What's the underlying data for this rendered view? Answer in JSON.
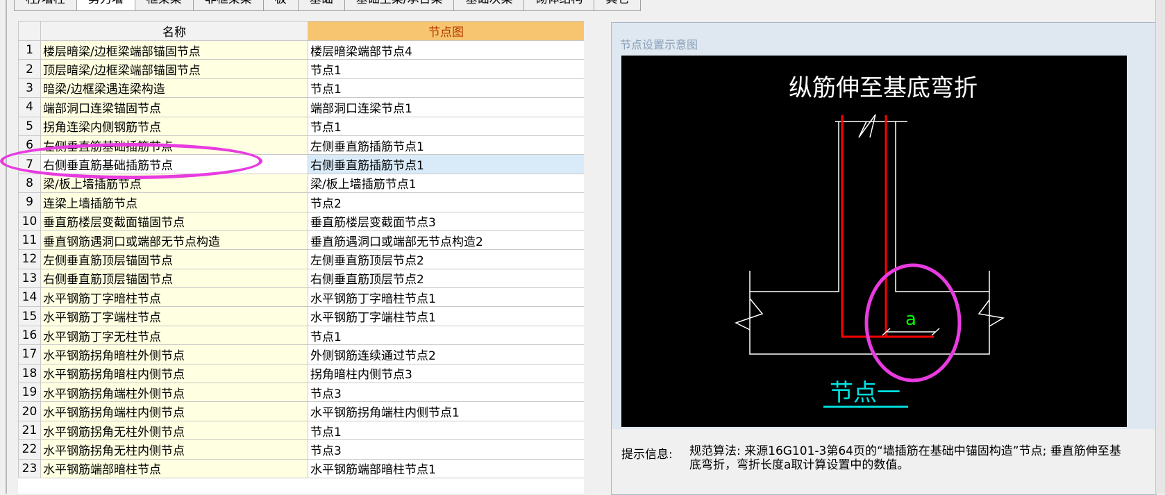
{
  "tabs": [
    {
      "label": "柱/墙柱",
      "active": false
    },
    {
      "label": "剪力墙",
      "active": true
    },
    {
      "label": "框架梁",
      "active": false
    },
    {
      "label": "非框架梁",
      "active": false
    },
    {
      "label": "板",
      "active": false
    },
    {
      "label": "基础",
      "active": false
    },
    {
      "label": "基础主梁/承台梁",
      "active": false
    },
    {
      "label": "基础次梁",
      "active": false
    },
    {
      "label": "砌体结构",
      "active": false
    },
    {
      "label": "其它",
      "active": false
    }
  ],
  "table": {
    "headers": {
      "name": "名称",
      "node": "节点图"
    },
    "selected_row": 7,
    "rows": [
      {
        "no": "1",
        "name": "楼层暗梁/边框梁端部锚固节点",
        "node": "楼层暗梁端部节点4"
      },
      {
        "no": "2",
        "name": "顶层暗梁/边框梁端部锚固节点",
        "node": "节点1"
      },
      {
        "no": "3",
        "name": "暗梁/边框梁遇连梁构造",
        "node": "节点1"
      },
      {
        "no": "4",
        "name": "端部洞口连梁锚固节点",
        "node": "端部洞口连梁节点1"
      },
      {
        "no": "5",
        "name": "拐角连梁内侧钢筋节点",
        "node": "节点1"
      },
      {
        "no": "6",
        "name": "左侧垂直筋基础插筋节点",
        "node": "左侧垂直筋插筋节点1"
      },
      {
        "no": "7",
        "name": "右侧垂直筋基础插筋节点",
        "node": "右侧垂直筋插筋节点1"
      },
      {
        "no": "8",
        "name": "梁/板上墙插筋节点",
        "node": "梁/板上墙插筋节点1"
      },
      {
        "no": "9",
        "name": "连梁上墙插筋节点",
        "node": "节点2"
      },
      {
        "no": "10",
        "name": "垂直筋楼层变截面锚固节点",
        "node": "垂直筋楼层变截面节点3"
      },
      {
        "no": "11",
        "name": "垂直钢筋遇洞口或端部无节点构造",
        "node": "垂直筋遇洞口或端部无节点构造2"
      },
      {
        "no": "12",
        "name": "左侧垂直筋顶层锚固节点",
        "node": "左侧垂直筋顶层节点2"
      },
      {
        "no": "13",
        "name": "右侧垂直筋顶层锚固节点",
        "node": "右侧垂直筋顶层节点2"
      },
      {
        "no": "14",
        "name": "水平钢筋丁字暗柱节点",
        "node": "水平钢筋丁字暗柱节点1"
      },
      {
        "no": "15",
        "name": "水平钢筋丁字端柱节点",
        "node": "水平钢筋丁字端柱节点1"
      },
      {
        "no": "16",
        "name": "水平钢筋丁字无柱节点",
        "node": "节点1"
      },
      {
        "no": "17",
        "name": "水平钢筋拐角暗柱外侧节点",
        "node": "外侧钢筋连续通过节点2"
      },
      {
        "no": "18",
        "name": "水平钢筋拐角暗柱内侧节点",
        "node": "拐角暗柱内侧节点3"
      },
      {
        "no": "19",
        "name": "水平钢筋拐角端柱外侧节点",
        "node": "节点3"
      },
      {
        "no": "20",
        "name": "水平钢筋拐角端柱内侧节点",
        "node": "水平钢筋拐角端柱内侧节点1"
      },
      {
        "no": "21",
        "name": "水平钢筋拐角无柱外侧节点",
        "node": "节点1"
      },
      {
        "no": "22",
        "name": "水平钢筋拐角无柱内侧节点",
        "node": "节点3"
      },
      {
        "no": "23",
        "name": "水平钢筋端部暗柱节点",
        "node": "水平钢筋端部暗柱节点1"
      }
    ]
  },
  "preview": {
    "panel_title": "节点设置示意图",
    "diagram_title": "纵筋伸至基底弯折",
    "dim_label": "a",
    "node_caption": "节点一",
    "colors": {
      "rebar": "#ff0000",
      "outline": "#ffffff",
      "dimension": "#00ff00",
      "caption": "#00e0e0",
      "annotation": "#e83be0"
    }
  },
  "tip": {
    "label": "提示信息:",
    "text": "规范算法: 来源16G101-3第64页的“墙插筋在基础中锚固构造”节点; 垂直筋伸至基底弯折，弯折长度a取计算设置中的数值。"
  }
}
